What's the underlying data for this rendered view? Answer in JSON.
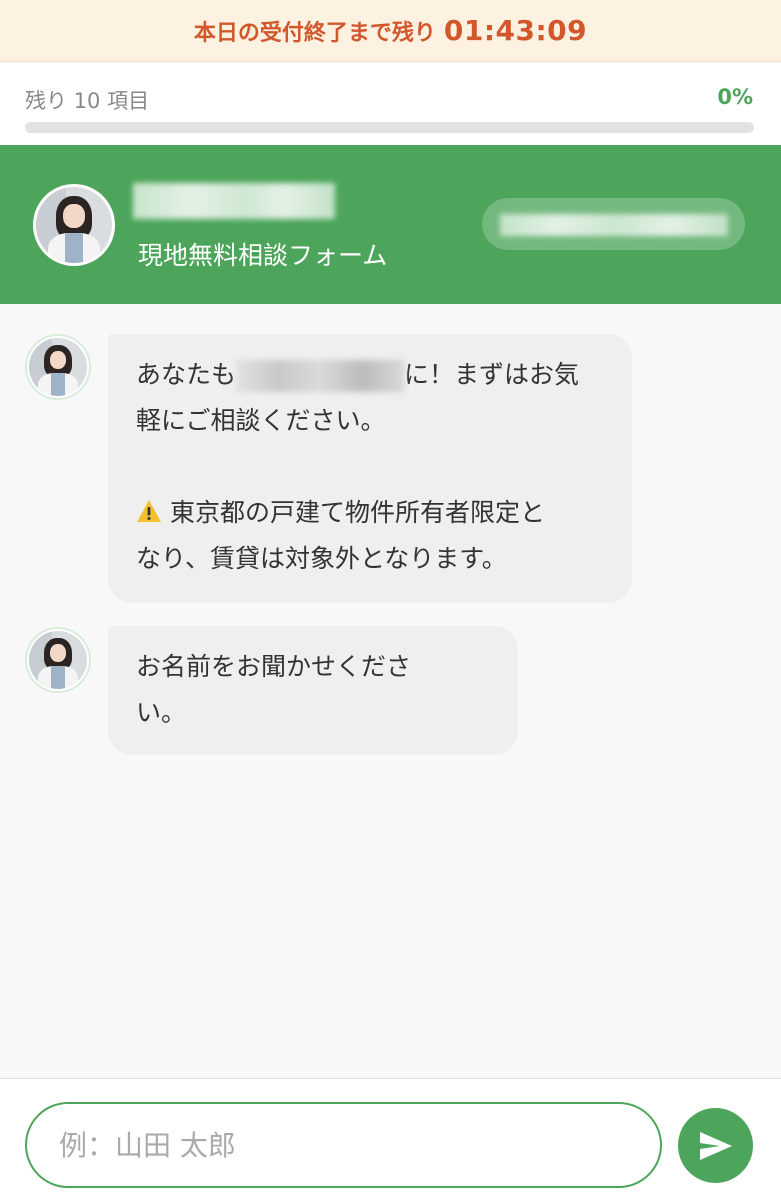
{
  "countdown": {
    "label": "本日の受付終了まで残り",
    "time": "01:43:09"
  },
  "progress": {
    "remaining_label": "残り 10 項目",
    "percent_label": "0%",
    "percent_value": 0
  },
  "header": {
    "subtitle": "現地無料相談フォーム"
  },
  "messages": [
    {
      "line1_before": "あなたも",
      "line1_after": "に！まずはお気",
      "line2": "軽にご相談ください。",
      "warning_line1": "東京都の戸建て物件所有者限定と",
      "warning_line2": "なり、賃貸は対象外となります。"
    },
    {
      "line1": "お名前をお聞かせくださ",
      "line2": "い。"
    }
  ],
  "input": {
    "placeholder": "例：山田 太郎"
  },
  "icons": {
    "warning": "warning-icon",
    "send": "send-icon"
  },
  "colors": {
    "accent_green": "#4ca55a",
    "countdown_orange": "#d2582b",
    "countdown_bg": "#fdf1e1"
  }
}
